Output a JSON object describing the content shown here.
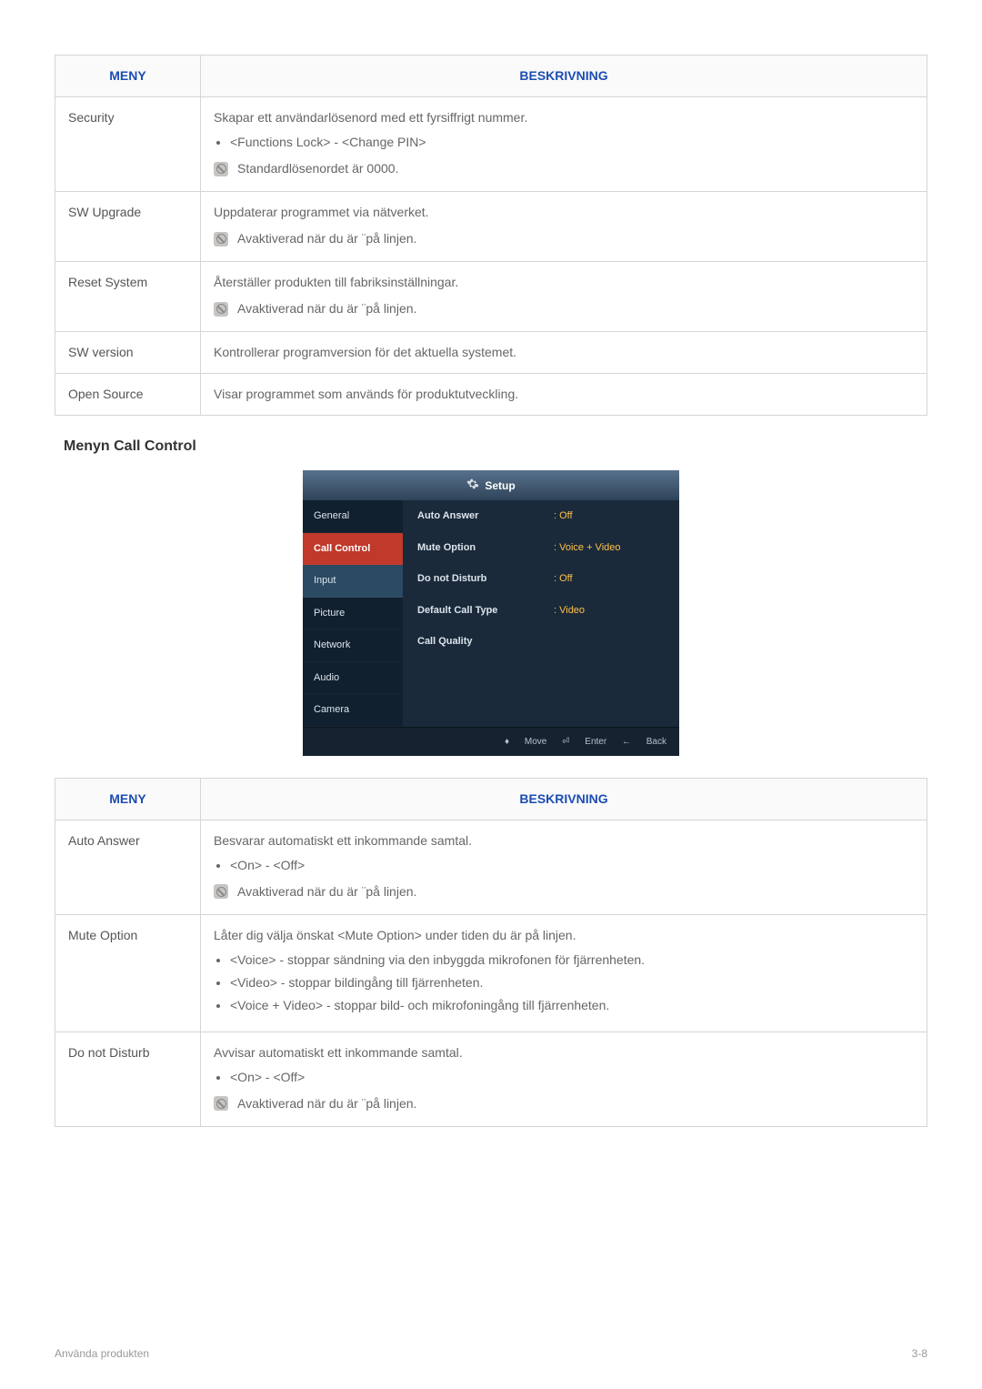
{
  "table1": {
    "headers": {
      "menu": "MENY",
      "desc": "BESKRIVNING"
    },
    "rows": [
      {
        "menu": "Security",
        "desc": "Skapar ett användarlösenord med ett fyrsiffrigt nummer.",
        "bullets": [
          "<Functions Lock> - <Change PIN>"
        ],
        "note": "Standardlösenordet är 0000."
      },
      {
        "menu": "SW Upgrade",
        "desc": "Uppdaterar programmet via nätverket.",
        "note": "Avaktiverad när du är ¨på linjen."
      },
      {
        "menu": "Reset System",
        "desc": "Återställer produkten till fabriksinställningar.",
        "note": "Avaktiverad när du är ¨på linjen."
      },
      {
        "menu": "SW version",
        "desc": "Kontrollerar programversion för det aktuella systemet."
      },
      {
        "menu": "Open Source",
        "desc": "Visar programmet som används för produktutveckling."
      }
    ]
  },
  "section_title": "Menyn Call Control",
  "setup": {
    "title": "Setup",
    "sidebar": [
      "General",
      "Call Control",
      "Input",
      "Picture",
      "Network",
      "Audio",
      "Camera"
    ],
    "active_index": 1,
    "hover_index": 2,
    "items": [
      {
        "label": "Auto Answer",
        "value": ": Off"
      },
      {
        "label": "Mute Option",
        "value": ": Voice + Video"
      },
      {
        "label": "Do not Disturb",
        "value": ": Off"
      },
      {
        "label": "Default Call Type",
        "value": ": Video"
      },
      {
        "label": "Call Quality",
        "value": ""
      }
    ],
    "footer": {
      "move": "Move",
      "enter": "Enter",
      "back": "Back"
    }
  },
  "table2": {
    "headers": {
      "menu": "MENY",
      "desc": "BESKRIVNING"
    },
    "rows": [
      {
        "menu": "Auto Answer",
        "desc": "Besvarar automatiskt ett inkommande samtal.",
        "bullets": [
          "<On> - <Off>"
        ],
        "note": "Avaktiverad när du är ¨på linjen."
      },
      {
        "menu": "Mute Option",
        "desc": "Låter dig välja önskat <Mute Option> under tiden du är på linjen.",
        "bullets": [
          "<Voice> - stoppar sändning via den inbyggda mikrofonen för fjärrenheten.",
          "<Video> - stoppar bildingång till fjärrenheten.",
          "<Voice + Video> - stoppar bild- och mikrofoningång till fjärrenheten."
        ]
      },
      {
        "menu": "Do not Disturb",
        "desc": "Avvisar automatiskt ett inkommande samtal.",
        "bullets": [
          "<On> - <Off>"
        ],
        "note": "Avaktiverad när du är ¨på linjen."
      }
    ]
  },
  "footer": {
    "left": "Använda produkten",
    "right": "3-8"
  }
}
